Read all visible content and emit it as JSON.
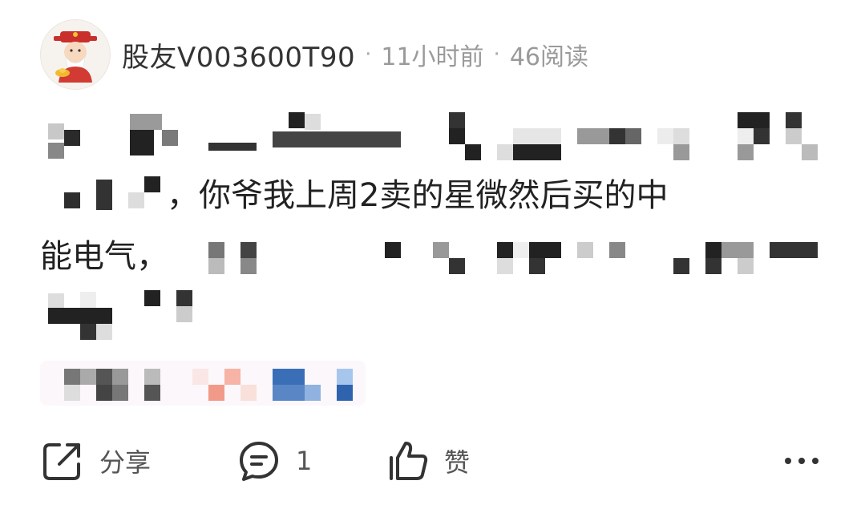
{
  "post": {
    "author": "股友V003600T90",
    "separator": "·",
    "time": "11小时前",
    "views": "46阅读",
    "lines": [
      "你爷我上周2卖的星微然后买的中",
      "能电气，"
    ],
    "line_prefix": "，"
  },
  "actions": {
    "share_label": "分享",
    "comment_count": "1",
    "like_label": "赞"
  },
  "icons": {
    "avatar": "caishen-avatar",
    "share": "share-icon",
    "comment": "comment-icon",
    "like": "thumbs-up-icon",
    "more": "more-icon"
  }
}
